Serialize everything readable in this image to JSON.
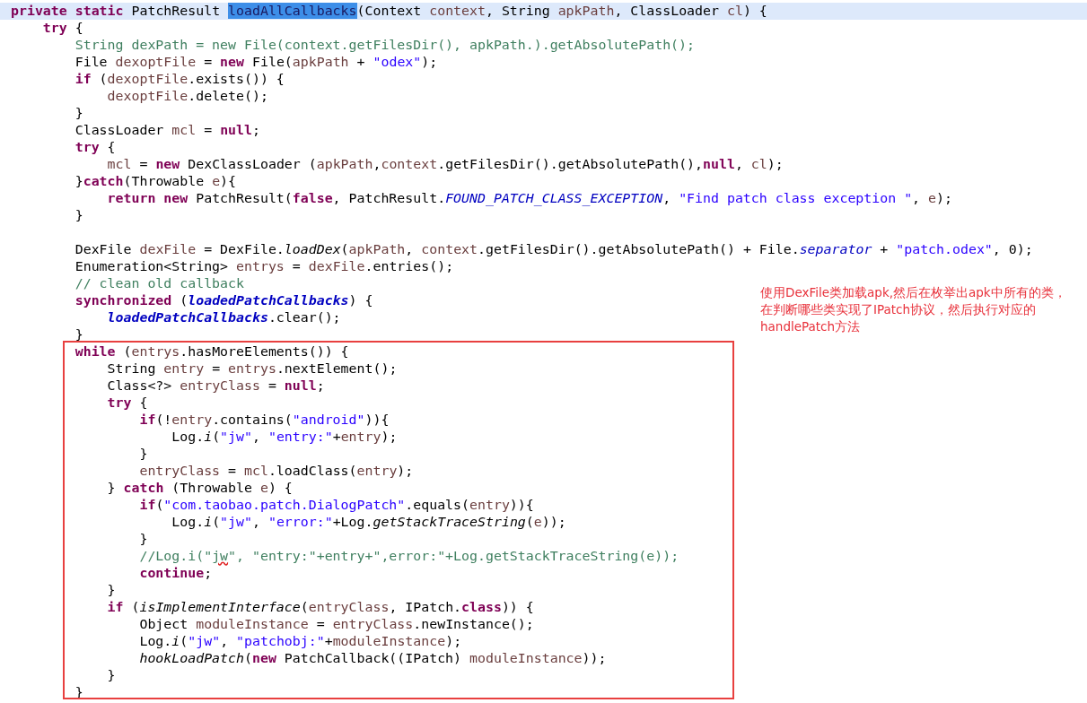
{
  "editor": {
    "lines": [
      {
        "kind": "code",
        "current": true,
        "tokens": [
          {
            "kind": "k",
            "text": "private static"
          },
          {
            "kind": "p",
            "text": " PatchResult "
          },
          {
            "kind": "sel",
            "text": "loadAllCallbacks"
          },
          {
            "kind": "p",
            "text": "(Context "
          },
          {
            "kind": "v",
            "text": "context"
          },
          {
            "kind": "p",
            "text": ", String "
          },
          {
            "kind": "v",
            "text": "apkPath"
          },
          {
            "kind": "p",
            "text": ", ClassLoader "
          },
          {
            "kind": "v",
            "text": "cl"
          },
          {
            "kind": "p",
            "text": ") {"
          }
        ]
      },
      {
        "kind": "code",
        "current": false,
        "tokens": [
          {
            "kind": "k",
            "text": "    try"
          },
          {
            "kind": "p",
            "text": " {"
          }
        ]
      },
      {
        "kind": "code",
        "current": false,
        "tokens": [
          {
            "kind": "c",
            "text": "        String dexPath = new File(context.getFilesDir(), apkPath.).getAbsolutePath();"
          }
        ]
      },
      {
        "kind": "code",
        "current": false,
        "tokens": [
          {
            "kind": "p",
            "text": "        File "
          },
          {
            "kind": "v",
            "text": "dexoptFile"
          },
          {
            "kind": "p",
            "text": " = "
          },
          {
            "kind": "k",
            "text": "new"
          },
          {
            "kind": "p",
            "text": " File("
          },
          {
            "kind": "v",
            "text": "apkPath"
          },
          {
            "kind": "p",
            "text": " + "
          },
          {
            "kind": "s",
            "text": "\"odex\""
          },
          {
            "kind": "p",
            "text": ");"
          }
        ]
      },
      {
        "kind": "code",
        "current": false,
        "tokens": [
          {
            "kind": "k",
            "text": "        if"
          },
          {
            "kind": "p",
            "text": " ("
          },
          {
            "kind": "v",
            "text": "dexoptFile"
          },
          {
            "kind": "p",
            "text": ".exists()) {"
          }
        ]
      },
      {
        "kind": "code",
        "current": false,
        "tokens": [
          {
            "kind": "v",
            "text": "            dexoptFile"
          },
          {
            "kind": "p",
            "text": ".delete();"
          }
        ]
      },
      {
        "kind": "code",
        "current": false,
        "tokens": [
          {
            "kind": "p",
            "text": "        }"
          }
        ]
      },
      {
        "kind": "code",
        "current": false,
        "tokens": [
          {
            "kind": "p",
            "text": "        ClassLoader "
          },
          {
            "kind": "v",
            "text": "mcl"
          },
          {
            "kind": "p",
            "text": " = "
          },
          {
            "kind": "k",
            "text": "null"
          },
          {
            "kind": "p",
            "text": ";"
          }
        ]
      },
      {
        "kind": "code",
        "current": false,
        "tokens": [
          {
            "kind": "k",
            "text": "        try"
          },
          {
            "kind": "p",
            "text": " {"
          }
        ]
      },
      {
        "kind": "code",
        "current": false,
        "tokens": [
          {
            "kind": "v",
            "text": "            mcl"
          },
          {
            "kind": "p",
            "text": " = "
          },
          {
            "kind": "k",
            "text": "new"
          },
          {
            "kind": "p",
            "text": " DexClassLoader ("
          },
          {
            "kind": "v",
            "text": "apkPath"
          },
          {
            "kind": "p",
            "text": ","
          },
          {
            "kind": "v",
            "text": "context"
          },
          {
            "kind": "p",
            "text": ".getFilesDir().getAbsolutePath(),"
          },
          {
            "kind": "k",
            "text": "null"
          },
          {
            "kind": "p",
            "text": ", "
          },
          {
            "kind": "v",
            "text": "cl"
          },
          {
            "kind": "p",
            "text": ");"
          }
        ]
      },
      {
        "kind": "code",
        "current": false,
        "tokens": [
          {
            "kind": "p",
            "text": "        }"
          },
          {
            "kind": "k",
            "text": "catch"
          },
          {
            "kind": "p",
            "text": "(Throwable "
          },
          {
            "kind": "v",
            "text": "e"
          },
          {
            "kind": "p",
            "text": "){"
          }
        ]
      },
      {
        "kind": "code",
        "current": false,
        "tokens": [
          {
            "kind": "k",
            "text": "            return new"
          },
          {
            "kind": "p",
            "text": " PatchResult("
          },
          {
            "kind": "k",
            "text": "false"
          },
          {
            "kind": "p",
            "text": ", PatchResult."
          },
          {
            "kind": "f",
            "text": "FOUND_PATCH_CLASS_EXCEPTION"
          },
          {
            "kind": "p",
            "text": ", "
          },
          {
            "kind": "s",
            "text": "\"Find patch class exception \""
          },
          {
            "kind": "p",
            "text": ", "
          },
          {
            "kind": "v",
            "text": "e"
          },
          {
            "kind": "p",
            "text": ");"
          }
        ]
      },
      {
        "kind": "code",
        "current": false,
        "tokens": [
          {
            "kind": "p",
            "text": "        }"
          }
        ]
      },
      {
        "kind": "blank"
      },
      {
        "kind": "code",
        "current": false,
        "tokens": [
          {
            "kind": "p",
            "text": "        DexFile "
          },
          {
            "kind": "v",
            "text": "dexFile"
          },
          {
            "kind": "p",
            "text": " = DexFile."
          },
          {
            "kind": "m",
            "text": "loadDex"
          },
          {
            "kind": "p",
            "text": "("
          },
          {
            "kind": "v",
            "text": "apkPath"
          },
          {
            "kind": "p",
            "text": ", "
          },
          {
            "kind": "v",
            "text": "context"
          },
          {
            "kind": "p",
            "text": ".getFilesDir().getAbsolutePath() + File."
          },
          {
            "kind": "f",
            "text": "separator"
          },
          {
            "kind": "p",
            "text": " + "
          },
          {
            "kind": "s",
            "text": "\"patch.odex\""
          },
          {
            "kind": "p",
            "text": ", 0);"
          }
        ]
      },
      {
        "kind": "code",
        "current": false,
        "tokens": [
          {
            "kind": "p",
            "text": "        Enumeration<String> "
          },
          {
            "kind": "v",
            "text": "entrys"
          },
          {
            "kind": "p",
            "text": " = "
          },
          {
            "kind": "v",
            "text": "dexFile"
          },
          {
            "kind": "p",
            "text": ".entries();"
          }
        ]
      },
      {
        "kind": "code",
        "current": false,
        "tokens": [
          {
            "kind": "c",
            "text": "        // clean old callback"
          }
        ]
      },
      {
        "kind": "code",
        "current": false,
        "tokens": [
          {
            "kind": "k",
            "text": "        synchronized"
          },
          {
            "kind": "p",
            "text": " ("
          },
          {
            "kind": "fb",
            "text": "loadedPatchCallbacks"
          },
          {
            "kind": "p",
            "text": ") {"
          }
        ]
      },
      {
        "kind": "code",
        "current": false,
        "tokens": [
          {
            "kind": "fb",
            "text": "            loadedPatchCallbacks"
          },
          {
            "kind": "p",
            "text": ".clear();"
          }
        ]
      },
      {
        "kind": "code",
        "current": false,
        "tokens": [
          {
            "kind": "p",
            "text": "        }"
          }
        ]
      },
      {
        "kind": "code",
        "current": false,
        "tokens": [
          {
            "kind": "k",
            "text": "        while"
          },
          {
            "kind": "p",
            "text": " ("
          },
          {
            "kind": "v",
            "text": "entrys"
          },
          {
            "kind": "p",
            "text": ".hasMoreElements()) {"
          }
        ]
      },
      {
        "kind": "code",
        "current": false,
        "tokens": [
          {
            "kind": "p",
            "text": "            String "
          },
          {
            "kind": "v",
            "text": "entry"
          },
          {
            "kind": "p",
            "text": " = "
          },
          {
            "kind": "v",
            "text": "entrys"
          },
          {
            "kind": "p",
            "text": ".nextElement();"
          }
        ]
      },
      {
        "kind": "code",
        "current": false,
        "tokens": [
          {
            "kind": "p",
            "text": "            Class<?> "
          },
          {
            "kind": "v",
            "text": "entryClass"
          },
          {
            "kind": "p",
            "text": " = "
          },
          {
            "kind": "k",
            "text": "null"
          },
          {
            "kind": "p",
            "text": ";"
          }
        ]
      },
      {
        "kind": "code",
        "current": false,
        "tokens": [
          {
            "kind": "k",
            "text": "            try"
          },
          {
            "kind": "p",
            "text": " {"
          }
        ]
      },
      {
        "kind": "code",
        "current": false,
        "tokens": [
          {
            "kind": "k",
            "text": "                if"
          },
          {
            "kind": "p",
            "text": "(!"
          },
          {
            "kind": "v",
            "text": "entry"
          },
          {
            "kind": "p",
            "text": ".contains("
          },
          {
            "kind": "s",
            "text": "\"android\""
          },
          {
            "kind": "p",
            "text": ")){"
          }
        ]
      },
      {
        "kind": "code",
        "current": false,
        "tokens": [
          {
            "kind": "p",
            "text": "                    Log."
          },
          {
            "kind": "m",
            "text": "i"
          },
          {
            "kind": "p",
            "text": "("
          },
          {
            "kind": "s",
            "text": "\"jw\""
          },
          {
            "kind": "p",
            "text": ", "
          },
          {
            "kind": "s",
            "text": "\"entry:\""
          },
          {
            "kind": "p",
            "text": "+"
          },
          {
            "kind": "v",
            "text": "entry"
          },
          {
            "kind": "p",
            "text": ");"
          }
        ]
      },
      {
        "kind": "code",
        "current": false,
        "tokens": [
          {
            "kind": "p",
            "text": "                }"
          }
        ]
      },
      {
        "kind": "code",
        "current": false,
        "tokens": [
          {
            "kind": "v",
            "text": "                entryClass"
          },
          {
            "kind": "p",
            "text": " = "
          },
          {
            "kind": "v",
            "text": "mcl"
          },
          {
            "kind": "p",
            "text": ".loadClass("
          },
          {
            "kind": "v",
            "text": "entry"
          },
          {
            "kind": "p",
            "text": ");"
          }
        ]
      },
      {
        "kind": "code",
        "current": false,
        "tokens": [
          {
            "kind": "p",
            "text": "            } "
          },
          {
            "kind": "k",
            "text": "catch"
          },
          {
            "kind": "p",
            "text": " (Throwable "
          },
          {
            "kind": "v",
            "text": "e"
          },
          {
            "kind": "p",
            "text": ") {"
          }
        ]
      },
      {
        "kind": "code",
        "current": false,
        "tokens": [
          {
            "kind": "k",
            "text": "                if"
          },
          {
            "kind": "p",
            "text": "("
          },
          {
            "kind": "s",
            "text": "\"com.taobao.patch.DialogPatch\""
          },
          {
            "kind": "p",
            "text": ".equals("
          },
          {
            "kind": "v",
            "text": "entry"
          },
          {
            "kind": "p",
            "text": ")){"
          }
        ]
      },
      {
        "kind": "code",
        "current": false,
        "tokens": [
          {
            "kind": "p",
            "text": "                    Log."
          },
          {
            "kind": "m",
            "text": "i"
          },
          {
            "kind": "p",
            "text": "("
          },
          {
            "kind": "s",
            "text": "\"jw\""
          },
          {
            "kind": "p",
            "text": ", "
          },
          {
            "kind": "s",
            "text": "\"error:\""
          },
          {
            "kind": "p",
            "text": "+Log."
          },
          {
            "kind": "m",
            "text": "getStackTraceString"
          },
          {
            "kind": "p",
            "text": "("
          },
          {
            "kind": "v",
            "text": "e"
          },
          {
            "kind": "p",
            "text": "));"
          }
        ]
      },
      {
        "kind": "code",
        "current": false,
        "tokens": [
          {
            "kind": "p",
            "text": "                }"
          }
        ]
      },
      {
        "kind": "code",
        "current": false,
        "tokens": [
          {
            "kind": "c",
            "text": "                //Log.i(\""
          },
          {
            "kind": "w",
            "text": "jw"
          },
          {
            "kind": "c",
            "text": "\", \"entry:\"+entry+\",error:\"+Log.getStackTraceString(e));"
          }
        ]
      },
      {
        "kind": "code",
        "current": false,
        "tokens": [
          {
            "kind": "k",
            "text": "                continue"
          },
          {
            "kind": "p",
            "text": ";"
          }
        ]
      },
      {
        "kind": "code",
        "current": false,
        "tokens": [
          {
            "kind": "p",
            "text": "            }"
          }
        ]
      },
      {
        "kind": "code",
        "current": false,
        "tokens": [
          {
            "kind": "k",
            "text": "            if"
          },
          {
            "kind": "p",
            "text": " ("
          },
          {
            "kind": "m",
            "text": "isImplementInterface"
          },
          {
            "kind": "p",
            "text": "("
          },
          {
            "kind": "v",
            "text": "entryClass"
          },
          {
            "kind": "p",
            "text": ", IPatch."
          },
          {
            "kind": "k",
            "text": "class"
          },
          {
            "kind": "p",
            "text": ")) {"
          }
        ]
      },
      {
        "kind": "code",
        "current": false,
        "tokens": [
          {
            "kind": "p",
            "text": "                Object "
          },
          {
            "kind": "v",
            "text": "moduleInstance"
          },
          {
            "kind": "p",
            "text": " = "
          },
          {
            "kind": "v",
            "text": "entryClass"
          },
          {
            "kind": "p",
            "text": ".newInstance();"
          }
        ]
      },
      {
        "kind": "code",
        "current": false,
        "tokens": [
          {
            "kind": "p",
            "text": "                Log."
          },
          {
            "kind": "m",
            "text": "i"
          },
          {
            "kind": "p",
            "text": "("
          },
          {
            "kind": "s",
            "text": "\"jw\""
          },
          {
            "kind": "p",
            "text": ", "
          },
          {
            "kind": "s",
            "text": "\"patchobj:\""
          },
          {
            "kind": "p",
            "text": "+"
          },
          {
            "kind": "v",
            "text": "moduleInstance"
          },
          {
            "kind": "p",
            "text": ");"
          }
        ]
      },
      {
        "kind": "code",
        "current": false,
        "tokens": [
          {
            "kind": "m",
            "text": "                hookLoadPatch"
          },
          {
            "kind": "p",
            "text": "("
          },
          {
            "kind": "k",
            "text": "new"
          },
          {
            "kind": "p",
            "text": " PatchCallback((IPatch) "
          },
          {
            "kind": "v",
            "text": "moduleInstance"
          },
          {
            "kind": "p",
            "text": "));"
          }
        ]
      },
      {
        "kind": "code",
        "current": false,
        "tokens": [
          {
            "kind": "p",
            "text": "            }"
          }
        ]
      },
      {
        "kind": "code",
        "current": false,
        "tokens": [
          {
            "kind": "p",
            "text": "        }"
          }
        ]
      }
    ]
  },
  "annotation": {
    "note": "使用DexFile类加载apk,然后在枚举出apk中所有的类，在判断哪些类实现了IPatch协议，然后执行对应的handlePatch方法"
  }
}
